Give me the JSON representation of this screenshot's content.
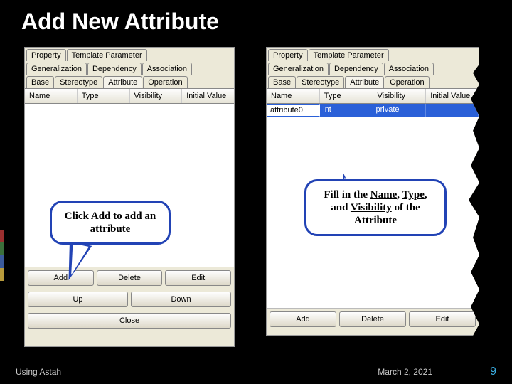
{
  "title": "Add New Attribute",
  "tabs": {
    "row1": [
      "Property",
      "Template Parameter"
    ],
    "row2": [
      "Generalization",
      "Dependency",
      "Association"
    ],
    "row3": [
      "Base",
      "Stereotype",
      "Attribute",
      "Operation"
    ],
    "active": "Attribute"
  },
  "columns": [
    "Name",
    "Type",
    "Visibility",
    "Initial Value"
  ],
  "left_panel": {
    "buttons_row1": [
      "Add",
      "Delete",
      "Edit"
    ],
    "buttons_row2": [
      "Up",
      "Down"
    ],
    "button_close": "Close"
  },
  "right_panel": {
    "row": {
      "name": "attribute0",
      "type": "int",
      "visibility": "private",
      "initial": ""
    },
    "buttons_row1": [
      "Add",
      "Delete",
      "Edit"
    ]
  },
  "callouts": {
    "left": "Click Add to add an attribute",
    "right_parts": [
      "Fill in the ",
      "Name",
      ", ",
      "Type",
      ", and ",
      "Visibility",
      " of the Attribute"
    ]
  },
  "footer": {
    "left": "Using Astah",
    "center": "March 2, 2021",
    "right": "9"
  }
}
